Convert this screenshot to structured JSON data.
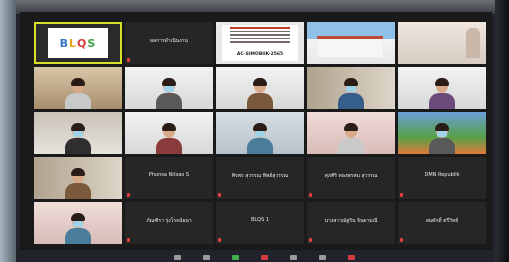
{
  "logo": {
    "letters": [
      "B",
      "L",
      "Q",
      "S"
    ]
  },
  "document_tile": {
    "title": "AC-SIMOBIIK-2565"
  },
  "tiles": [
    {
      "kind": "logo",
      "active": true
    },
    {
      "kind": "name",
      "label": "ผลการดำเนินงาน"
    },
    {
      "kind": "document"
    },
    {
      "kind": "building"
    },
    {
      "kind": "pale-room"
    },
    {
      "kind": "video",
      "bg": "bg-warm",
      "label": ""
    },
    {
      "kind": "video",
      "bg": "bg-white",
      "label": ""
    },
    {
      "kind": "video",
      "bg": "bg-white",
      "label": ""
    },
    {
      "kind": "video",
      "bg": "bg-shelf",
      "label": ""
    },
    {
      "kind": "video",
      "bg": "bg-white",
      "label": ""
    },
    {
      "kind": "video",
      "bg": "bg-office",
      "label": ""
    },
    {
      "kind": "video",
      "bg": "bg-white",
      "label": ""
    },
    {
      "kind": "video",
      "bg": "bg-room2",
      "label": ""
    },
    {
      "kind": "video",
      "bg": "bg-pink",
      "label": ""
    },
    {
      "kind": "video",
      "bg": "bg-garden",
      "label": ""
    },
    {
      "kind": "video",
      "bg": "bg-shelf",
      "label": ""
    },
    {
      "kind": "name",
      "label": "Phonsa Nitsao S"
    },
    {
      "kind": "name",
      "label": "ศิรพร สุวรรณ ทิพย์สุวรรณ"
    },
    {
      "kind": "name",
      "label": "ศุภศิริ ทองพรหม สุวรรณ"
    },
    {
      "kind": "name",
      "label": "DMN Republik"
    },
    {
      "kind": "video",
      "bg": "bg-pink",
      "label": ""
    },
    {
      "kind": "name",
      "label": "ภัณฑิรา รุ่งโรจน์ธนา"
    },
    {
      "kind": "name",
      "label": "BLQS 1"
    },
    {
      "kind": "name",
      "label": "นางสาวณัฐริน จินดามณี"
    },
    {
      "kind": "name",
      "label": "สมศักดิ์ ตรีวิทย์"
    }
  ],
  "colors": {
    "active_border": "#d9e025",
    "mute": "#e04040"
  }
}
